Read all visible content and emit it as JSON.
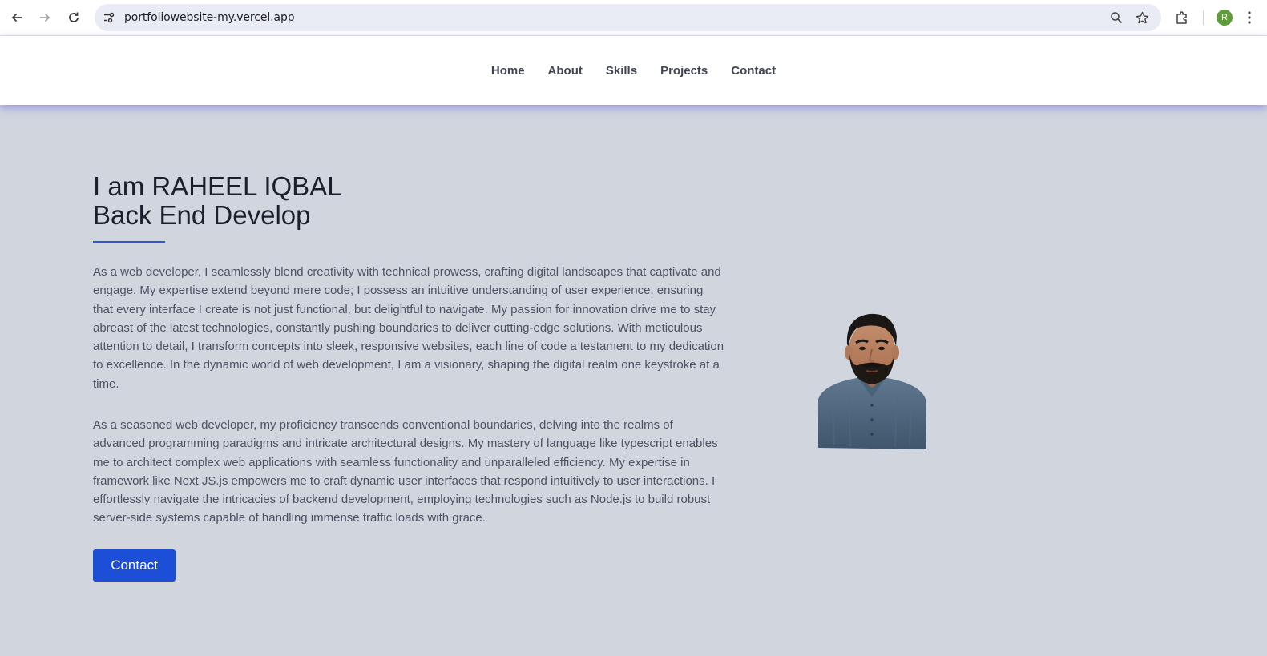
{
  "browser": {
    "url": "portfoliowebsite-my.vercel.app",
    "profile_initial": "R"
  },
  "nav": {
    "items": [
      "Home",
      "About",
      "Skills",
      "Projects",
      "Contact"
    ]
  },
  "hero": {
    "title_line1": "I am RAHEEL IQBAL",
    "title_line2": "Back End Develop",
    "paragraph1": "As a web developer, I seamlessly blend creativity with technical prowess, crafting digital landscapes that captivate and engage. My expertise extend beyond mere code; I possess an intuitive understanding of user experience, ensuring that every interface I create is not just functional, but delightful to navigate. My passion for innovation drive me to stay abreast of the latest technologies, constantly pushing boundaries to deliver cutting-edge solutions. With meticulous attention to detail, I transform concepts into sleek, responsive websites, each line of code a testament to my dedication to excellence. In the dynamic world of web development, I am a visionary, shaping the digital realm one keystroke at a time.",
    "paragraph2": "As a seasoned web developer, my proficiency transcends conventional boundaries, delving into the realms of advanced programming paradigms and intricate architectural designs. My mastery of language like typescript enables me to architect complex web applications with seamless functionality and unparalleled efficiency. My expertise in framework like Next JS.js empowers me to craft dynamic user interfaces that respond intuitively to user interactions. I effortlessly navigate the intricacies of backend development, employing technologies such as Node.js to build robust server-side systems capable of handling immense traffic loads with grace.",
    "contact_label": "Contact"
  },
  "colors": {
    "accent": "#1d4ed8",
    "page_bg": "#d1d5de",
    "header_shadow": "#6e69e6"
  }
}
